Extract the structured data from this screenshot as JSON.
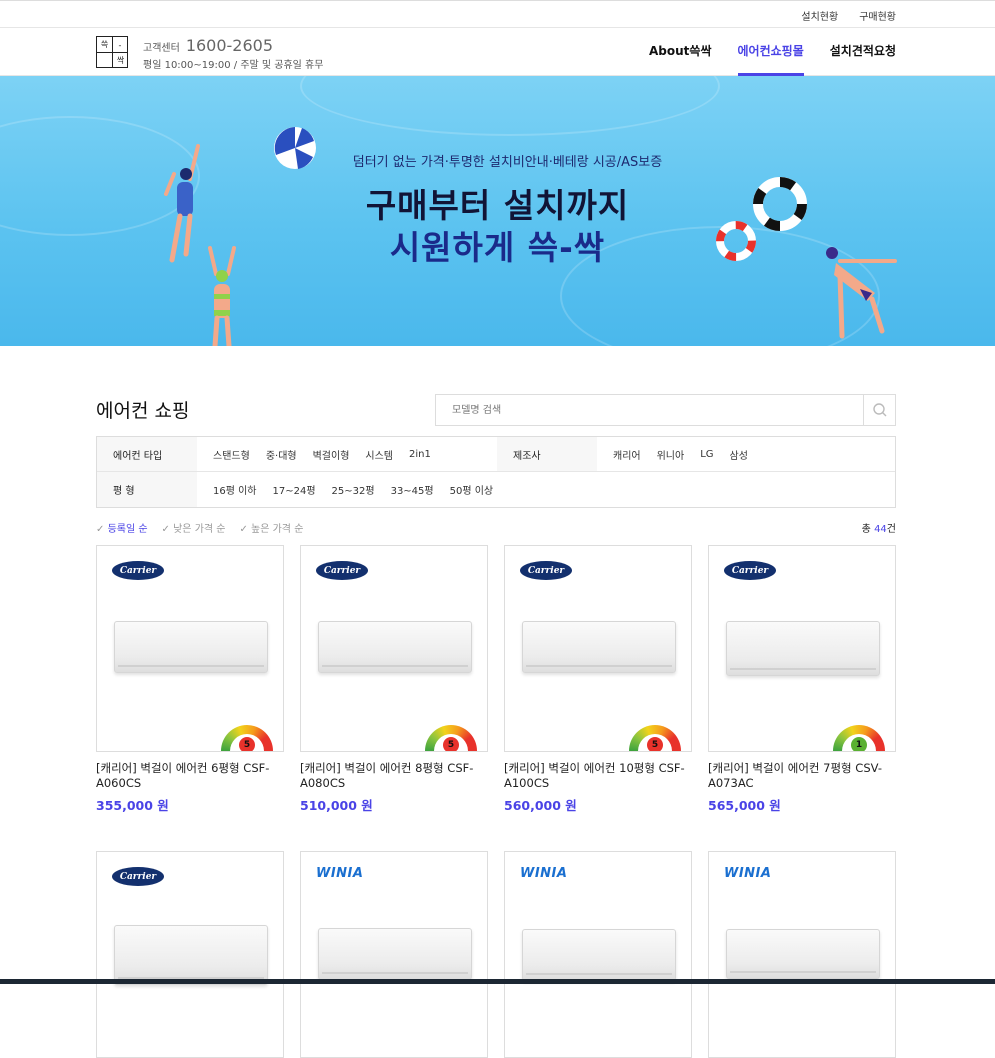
{
  "topbar": {
    "links": [
      "설치현황",
      "구매현황"
    ]
  },
  "logo": {
    "tl": "쓱",
    "tr": "-",
    "br": "싹"
  },
  "customer_service": {
    "label": "고객센터",
    "phone": "1600-2605",
    "hours": "평일 10:00~19:00 / 주말 및 공휴일 휴무"
  },
  "nav": [
    {
      "label": "About쓱싹",
      "active": false
    },
    {
      "label": "에어컨쇼핑몰",
      "active": true
    },
    {
      "label": "설치견적요청",
      "active": false
    }
  ],
  "banner": {
    "subtitle": "덤터기 없는 가격·투명한 설치비안내·베테랑 시공/AS보증",
    "title_line1": "구매부터 설치까지",
    "title_line2": "시원하게 쓱-싹"
  },
  "shop": {
    "title": "에어컨 쇼핑",
    "search_placeholder": "모델명 검색"
  },
  "filters": {
    "type_label": "에어컨 타입",
    "types": [
      "스탠드형",
      "중·대형",
      "벽걸이형",
      "시스템",
      "2in1"
    ],
    "maker_label": "제조사",
    "makers": [
      "캐리어",
      "위니아",
      "LG",
      "삼성"
    ],
    "size_label": "평 형",
    "sizes": [
      "16평 이하",
      "17~24평",
      "25~32평",
      "33~45평",
      "50평 이상"
    ]
  },
  "sort": {
    "options": [
      "등록일 순",
      "낮은 가격 순",
      "높은 가격 순"
    ],
    "active": 0,
    "total_prefix": "총 ",
    "total_count": "44",
    "total_suffix": "건"
  },
  "products": [
    {
      "brand": "Carrier",
      "name": "[캐리어] 벽걸이 에어컨 6평형 CSF-A060CS",
      "price": "355,000 원",
      "grade": "5",
      "grade_color": "#e8322b"
    },
    {
      "brand": "Carrier",
      "name": "[캐리어] 벽걸이 에어컨 8평형 CSF-A080CS",
      "price": "510,000 원",
      "grade": "5",
      "grade_color": "#e8322b"
    },
    {
      "brand": "Carrier",
      "name": "[캐리어] 벽걸이 에어컨 10평형 CSF-A100CS",
      "price": "560,000 원",
      "grade": "5",
      "grade_color": "#e8322b"
    },
    {
      "brand": "Carrier",
      "name": "[캐리어] 벽걸이 에어컨 7평형 CSV-A073AC",
      "price": "565,000 원",
      "grade": "1",
      "grade_color": "#5ab031"
    },
    {
      "brand": "Carrier",
      "name": "",
      "price": "",
      "grade": "",
      "grade_color": ""
    },
    {
      "brand": "WINIA",
      "name": "",
      "price": "",
      "grade": "",
      "grade_color": ""
    },
    {
      "brand": "WINIA",
      "name": "",
      "price": "",
      "grade": "",
      "grade_color": ""
    },
    {
      "brand": "WINIA",
      "name": "",
      "price": "",
      "grade": "",
      "grade_color": ""
    }
  ],
  "colors": {
    "accent": "#4a43e6",
    "banner": "#5cc3f0"
  }
}
